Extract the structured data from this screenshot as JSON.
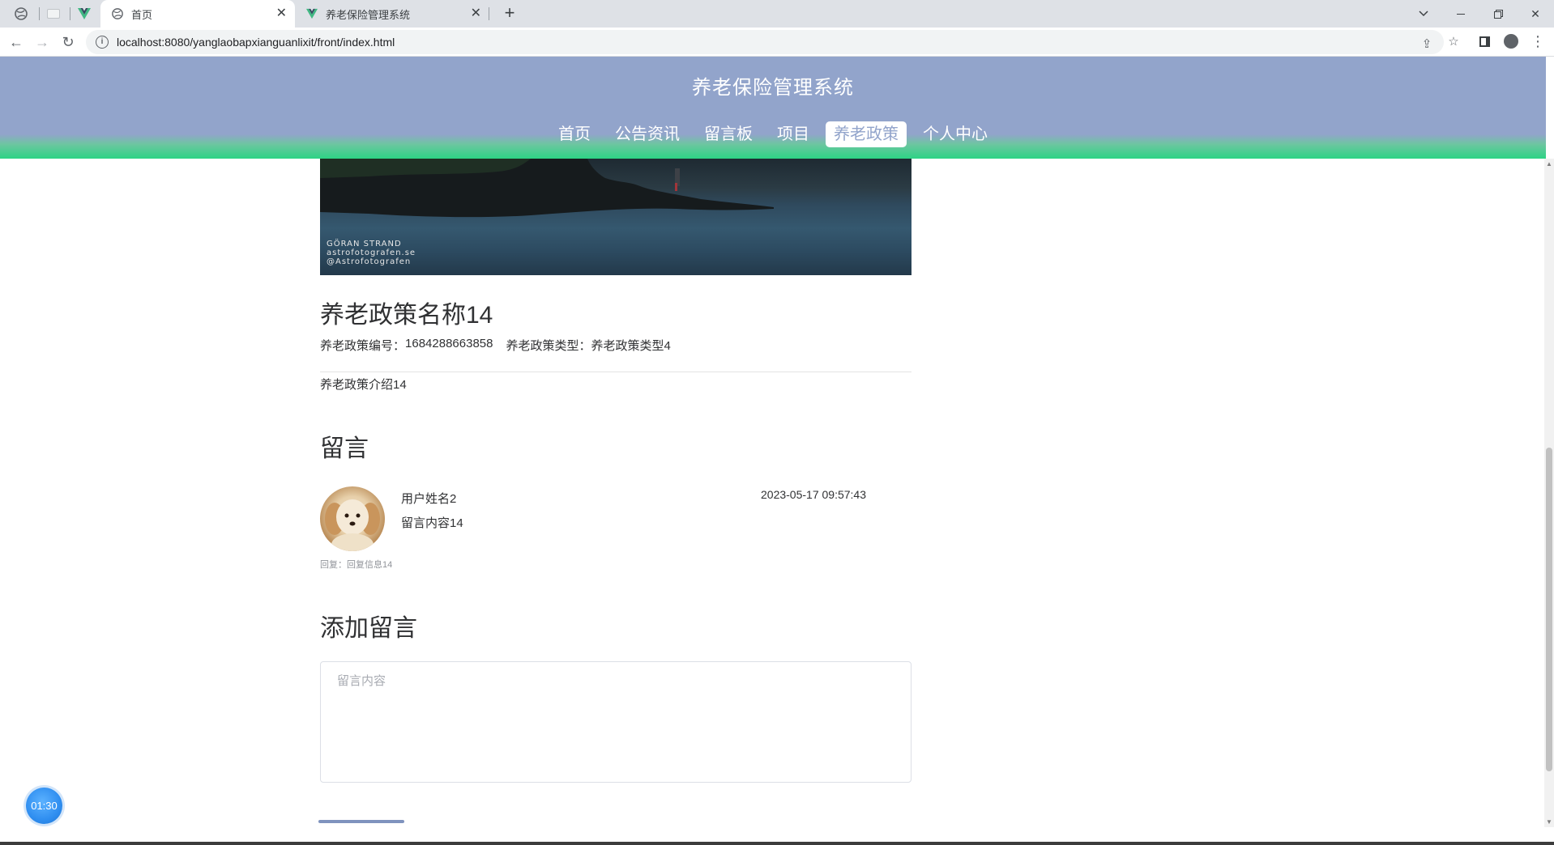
{
  "browser": {
    "tabs": [
      {
        "title": "首页",
        "active": true
      },
      {
        "title": "养老保险管理系统",
        "active": false
      }
    ],
    "url": "localhost:8080/yanglaobapxianguanlixit/front/index.html"
  },
  "site": {
    "title": "养老保险管理系统",
    "nav": [
      {
        "label": "首页",
        "active": false
      },
      {
        "label": "公告资讯",
        "active": false
      },
      {
        "label": "留言板",
        "active": false
      },
      {
        "label": "项目",
        "active": false
      },
      {
        "label": "养老政策",
        "active": true
      },
      {
        "label": "个人中心",
        "active": false
      }
    ]
  },
  "banner": {
    "watermark": [
      "GÖRAN STRAND",
      "astrofotografen.se",
      "@Astrofotografen"
    ]
  },
  "policy": {
    "title": "养老政策名称14",
    "number_label": "养老政策编号：",
    "number_value": "1684288663858",
    "type_label": "养老政策类型：",
    "type_value": "养老政策类型4",
    "intro": "养老政策介绍14"
  },
  "comments": {
    "heading": "留言",
    "items": [
      {
        "user": "用户姓名2",
        "content": "留言内容14",
        "time": "2023-05-17 09:57:43",
        "reply": "回复：回复信息14"
      }
    ]
  },
  "add_comment": {
    "heading": "添加留言",
    "placeholder": "留言内容"
  },
  "timer": "01:30",
  "colors": {
    "header": "#92a4cb",
    "header_accent": "#2dd385"
  }
}
